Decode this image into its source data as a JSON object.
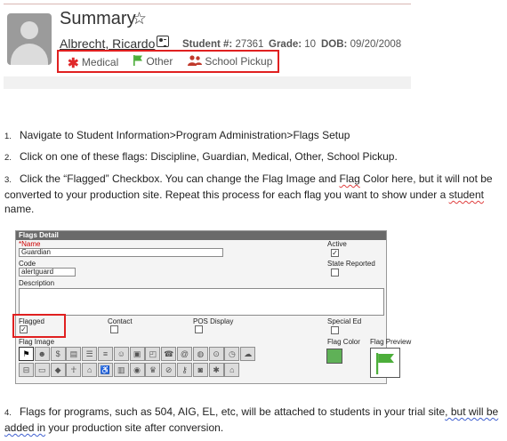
{
  "header": {
    "title": "Summary",
    "star_glyph": "☆",
    "student_name": "Albrecht, Ricardo",
    "student_num_label": "Student #:",
    "student_num": "27361",
    "grade_label": "Grade:",
    "grade": "10",
    "dob_label": "DOB:",
    "dob": "09/20/2008",
    "flags": [
      {
        "label": "Medical",
        "icon": "asterisk-icon",
        "color": "#e0282a"
      },
      {
        "label": "Other",
        "icon": "flag-icon",
        "color": "#4cae3a"
      },
      {
        "label": "School Pickup",
        "icon": "people-icon",
        "color": "#c0392b"
      }
    ]
  },
  "steps": [
    {
      "num": "1.",
      "text": "Navigate to Student Information>Program Administration>Flags Setup"
    },
    {
      "num": "2.",
      "text": "Click on one of these flags: Discipline, Guardian, Medical, Other, School Pickup."
    },
    {
      "num": "3.",
      "line1_a": "Click the “Flagged” Checkbox.  You can change the Flag Image and ",
      "line1_flag": "Flag",
      "line1_b": " Color here, but it will not be",
      "line2_a": "converted to your production site.  Repeat this process for each flag you want to show under a ",
      "line2_student": "student",
      "line3": "name."
    },
    {
      "num": "4.",
      "line1_a": "Flags for programs, such as 504, AIG, EL, etc, will be attached to students in your trial site",
      "line1_b": ", but will be",
      "line2_a": "added in",
      "line2_b": " your production site after conversion."
    }
  ],
  "flags_detail": {
    "title": "Flags Detail",
    "name_required_mark": "*",
    "name_label": "Name",
    "name_value": "Guardian",
    "code_label": "Code",
    "code_value": "alertguard",
    "description_label": "Description",
    "active_label": "Active",
    "active_checked": true,
    "state_reported_label": "State Reported",
    "state_reported_checked": false,
    "flagged_label": "Flagged",
    "flagged_checked": true,
    "contact_label": "Contact",
    "pos_display_label": "POS Display",
    "special_ed_label": "Special Ed",
    "flag_image_label": "Flag Image",
    "flag_color_label": "Flag Color",
    "flag_color": "#5fb157",
    "flag_preview_label": "Flag Preview",
    "icons_row1": [
      "flag",
      "person-card",
      "dollar",
      "id-card",
      "list",
      "checklist",
      "group",
      "lock",
      "unlock",
      "phone",
      "at",
      "globe",
      "pin",
      "clock",
      "cloud"
    ],
    "icons_row2": [
      "car",
      "bus",
      "tag",
      "run",
      "building",
      "wheelchair",
      "book",
      "eye",
      "trophy",
      "ban",
      "key",
      "camera",
      "asterisk",
      "house"
    ]
  }
}
